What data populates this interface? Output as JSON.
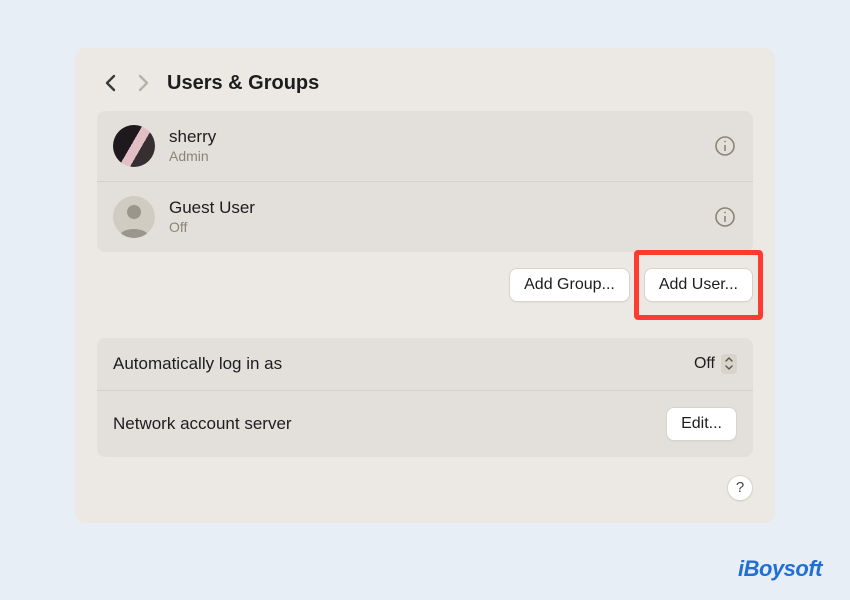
{
  "header": {
    "title": "Users & Groups"
  },
  "users": [
    {
      "name": "sherry",
      "role": "Admin"
    },
    {
      "name": "Guest User",
      "role": "Off"
    }
  ],
  "buttons": {
    "add_group": "Add Group...",
    "add_user": "Add User..."
  },
  "settings": {
    "auto_login_label": "Automatically log in as",
    "auto_login_value": "Off",
    "network_server_label": "Network account server",
    "edit_label": "Edit..."
  },
  "help_label": "?",
  "watermark": "iBoysoft",
  "colors": {
    "highlight": "#ff3b2f",
    "brand": "#1f6fd6"
  }
}
